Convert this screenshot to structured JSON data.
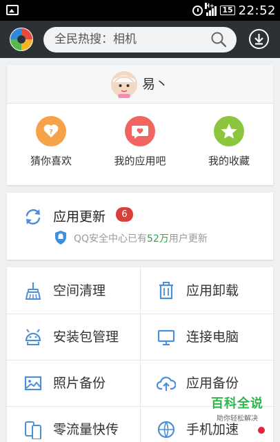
{
  "status_bar": {
    "time": "22:52",
    "battery": "15",
    "network": "H+"
  },
  "header": {
    "search_placeholder": "全民热搜：相机"
  },
  "profile": {
    "username": "易丶"
  },
  "quick_actions": [
    {
      "label": "猜你喜欢",
      "icon": "question-icon",
      "color": "#f5a24b"
    },
    {
      "label": "我的应用吧",
      "icon": "chat-heart-icon",
      "color": "#f0655f"
    },
    {
      "label": "我的收藏",
      "icon": "star-icon",
      "color": "#8cc63f"
    }
  ],
  "update": {
    "title": "应用更新",
    "badge": "6",
    "sub_prefix": "QQ安全中心已有",
    "sub_highlight": "52万",
    "sub_suffix": "用户更新"
  },
  "tools": [
    {
      "label": "空间清理",
      "icon": "broom-icon"
    },
    {
      "label": "应用卸载",
      "icon": "trash-icon"
    },
    {
      "label": "安装包管理",
      "icon": "android-icon"
    },
    {
      "label": "连接电脑",
      "icon": "monitor-icon"
    },
    {
      "label": "照片备份",
      "icon": "photo-icon"
    },
    {
      "label": "应用备份",
      "icon": "cloud-upload-icon"
    },
    {
      "label": "零流量快传",
      "icon": "phone-transfer-icon"
    },
    {
      "label": "手机加速",
      "icon": "speed-icon"
    }
  ],
  "watermark": {
    "title": "百科全说",
    "subtitle": "助你轻松解决"
  },
  "colors": {
    "accent": "#4a8fd8",
    "header_bg": "#2c3136",
    "badge_red": "#d9403b",
    "highlight_green": "#2fa843"
  }
}
